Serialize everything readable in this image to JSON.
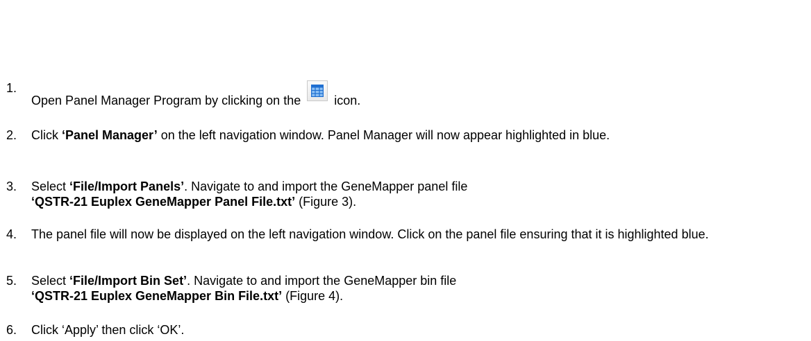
{
  "steps": [
    {
      "number": "1.",
      "text_before_icon": "Open Panel Manager Program by clicking on the",
      "icon": "grid-table-icon",
      "text_after_icon": "icon."
    },
    {
      "number": "2.",
      "pre": "Click",
      "bold": "‘Panel Manager’",
      "post": "on the left navigation window. Panel Manager will now appear highlighted in blue."
    },
    {
      "number": "3.",
      "pre": "Select",
      "bold": "‘File/Import Panels’",
      "post": ". Navigate to and import the GeneMapper panel file",
      "bold2": "‘QSTR-21 Euplex GeneMapper Panel File.txt’",
      "post2": "(Figure 3)."
    },
    {
      "number": "4.",
      "text": "The panel file will now be displayed on the left navigation window. Click on the panel file ensuring that it is highlighted blue."
    },
    {
      "number": "5.",
      "pre": "Select",
      "bold": "‘File/Import Bin Set’",
      "post": ". Navigate to and import the GeneMapper bin file",
      "bold2": "‘QSTR-21 Euplex GeneMapper Bin File.txt’",
      "post2": "(Figure 4)."
    },
    {
      "number": "6.",
      "text": "Click ‘Apply’ then click ‘OK’."
    }
  ],
  "colors": {
    "icon_grid": "#1f6fd1",
    "icon_cells": "#8fc2f5"
  }
}
